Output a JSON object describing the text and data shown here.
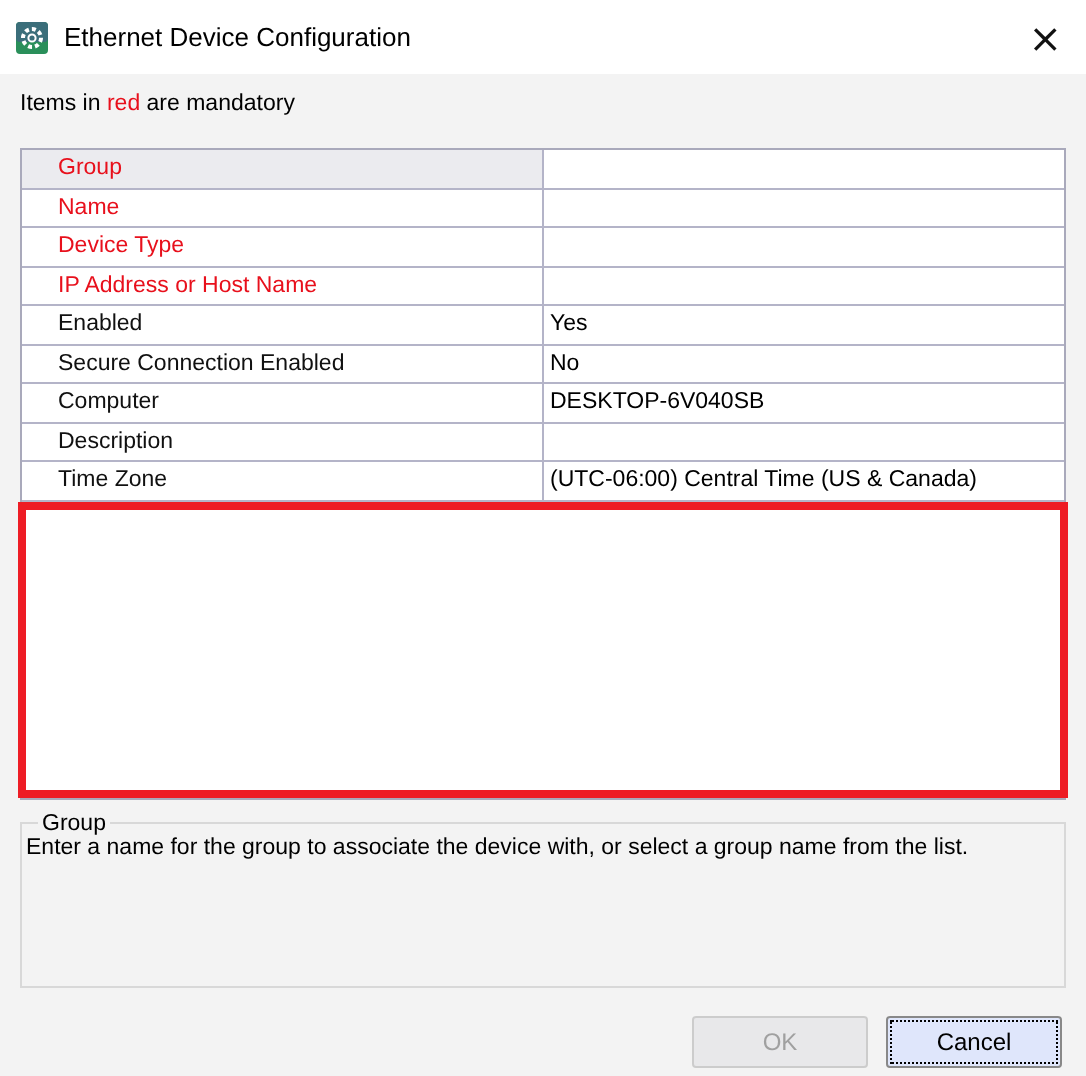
{
  "window": {
    "title": "Ethernet Device Configuration",
    "close": "×"
  },
  "legend": "Items in *red* are mandatory",
  "table": {
    "rows": [
      {
        "label": "Group",
        "mandatory": true,
        "selected": true
      },
      {
        "label": "Name",
        "mandatory": true,
        "selected": false
      },
      {
        "label": "Device Type",
        "mandatory": true,
        "selected": false
      },
      {
        "label": "IP Address or Host Name",
        "mandatory": true,
        "selected": false
      },
      {
        "label": "Enabled",
        "value": "Yes",
        "mandatory": false,
        "selected": false
      },
      {
        "label": "Secure Connection Enabled",
        "value": "No",
        "mandatory": false,
        "selected": false
      },
      {
        "label": "Computer",
        "value": "DESKTOP-6V040SB",
        "mandatory": false,
        "selected": false
      },
      {
        "label": "Description",
        "mandatory": false,
        "selected": false
      },
      {
        "label": "Time Zone",
        "value": "(UTC-06:00) Central Time (US & Canada)",
        "mandatory": false,
        "selected": false
      }
    ],
    "empty_area_highlighted": true
  },
  "help": {
    "title": "Group",
    "text": "Enter a name for the group to associate the device with, or select a group name from the list."
  },
  "buttons": [
    {
      "label": "OK",
      "disabled": true,
      "focused": false
    },
    {
      "label": "Cancel",
      "disabled": false,
      "focused": true
    }
  ]
}
